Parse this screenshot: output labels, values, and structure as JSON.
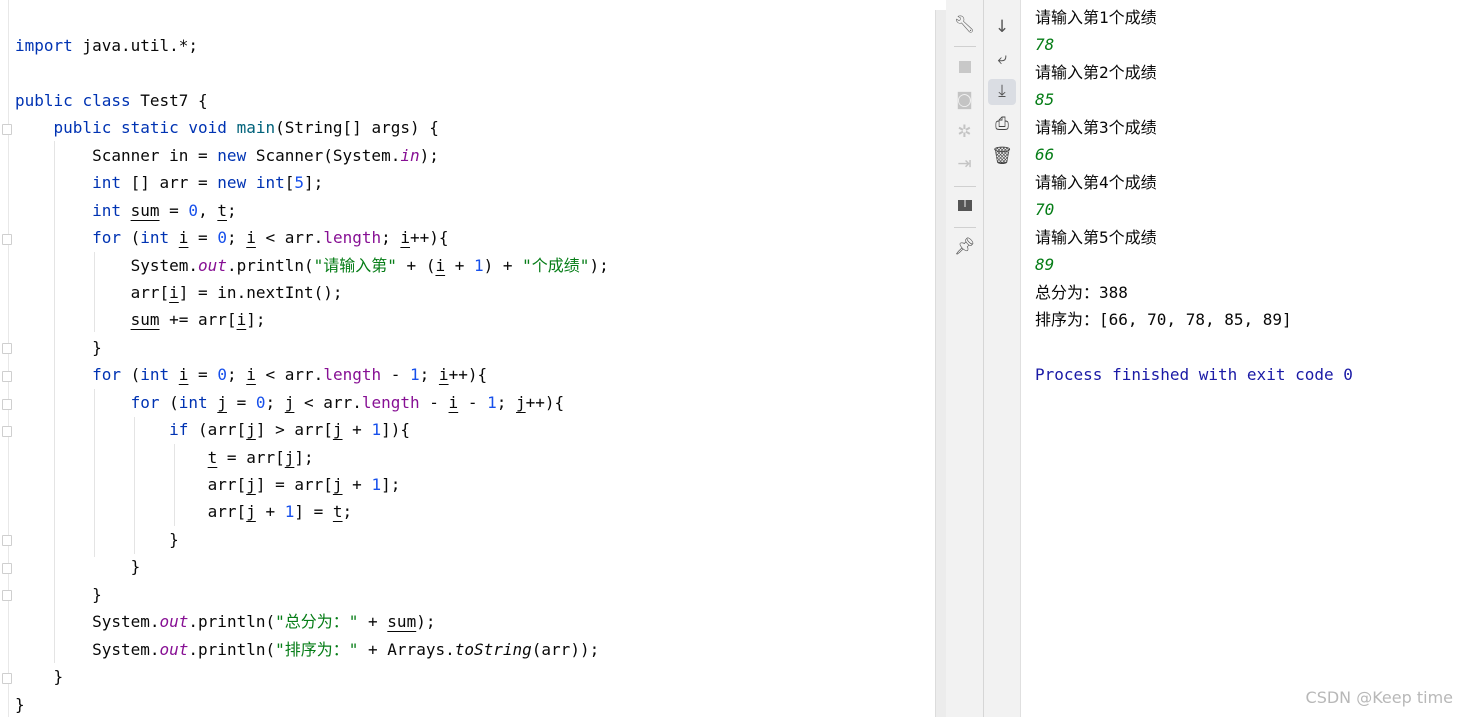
{
  "editor": {
    "lines": [
      [
        [
          "import",
          "k"
        ],
        " java.util.*;"
      ],
      [],
      [
        [
          "public",
          "k"
        ],
        " ",
        [
          "class",
          "k"
        ],
        " Test7 {"
      ],
      [
        "    ",
        [
          "public",
          "k"
        ],
        " ",
        [
          "static",
          "k"
        ],
        " ",
        [
          "void",
          "k"
        ],
        " ",
        [
          "main",
          "m"
        ],
        "(String[] args) {"
      ],
      [
        "        Scanner in = ",
        [
          "new",
          "k"
        ],
        " Scanner(System.",
        [
          "in",
          "f"
        ],
        ");"
      ],
      [
        "        ",
        [
          "int",
          "k"
        ],
        " [] arr = ",
        [
          "new",
          "k"
        ],
        " ",
        [
          "int",
          "k"
        ],
        "[",
        [
          "5",
          "n"
        ],
        "];"
      ],
      [
        "        ",
        [
          "int",
          "k"
        ],
        " ",
        [
          "sum",
          "u"
        ],
        " = ",
        [
          "0",
          "n"
        ],
        ", ",
        [
          "t",
          "u"
        ],
        ";"
      ],
      [
        "        ",
        [
          "for",
          "k"
        ],
        " (",
        [
          "int",
          "k"
        ],
        " ",
        [
          "i",
          "u"
        ],
        " = ",
        [
          "0",
          "n"
        ],
        "; ",
        [
          "i",
          "u"
        ],
        " < arr.",
        [
          "length",
          "fl"
        ],
        "; ",
        [
          "i",
          "u"
        ],
        "++){"
      ],
      [
        "            System.",
        [
          "out",
          "f"
        ],
        ".println(",
        [
          "\"请输入第\"",
          "s"
        ],
        " + (",
        [
          "i",
          "u"
        ],
        " + ",
        [
          "1",
          "n"
        ],
        ") + ",
        [
          "\"个成绩\"",
          "s"
        ],
        ");"
      ],
      [
        "            arr[",
        [
          "i",
          "u"
        ],
        "] = in.nextInt();"
      ],
      [
        "            ",
        [
          "sum",
          "u"
        ],
        " += arr[",
        [
          "i",
          "u"
        ],
        "];"
      ],
      [
        "        }"
      ],
      [
        "        ",
        [
          "for",
          "k"
        ],
        " (",
        [
          "int",
          "k"
        ],
        " ",
        [
          "i",
          "u"
        ],
        " = ",
        [
          "0",
          "n"
        ],
        "; ",
        [
          "i",
          "u"
        ],
        " < arr.",
        [
          "length",
          "fl"
        ],
        " - ",
        [
          "1",
          "n"
        ],
        "; ",
        [
          "i",
          "u"
        ],
        "++){"
      ],
      [
        "            ",
        [
          "for",
          "k"
        ],
        " (",
        [
          "int",
          "k"
        ],
        " ",
        [
          "j",
          "u"
        ],
        " = ",
        [
          "0",
          "n"
        ],
        "; ",
        [
          "j",
          "u"
        ],
        " < arr.",
        [
          "length",
          "fl"
        ],
        " - ",
        [
          "i",
          "u"
        ],
        " - ",
        [
          "1",
          "n"
        ],
        "; ",
        [
          "j",
          "u"
        ],
        "++){"
      ],
      [
        "                ",
        [
          "if",
          "k"
        ],
        " (arr[",
        [
          "j",
          "u"
        ],
        "] > arr[",
        [
          "j",
          "u"
        ],
        " + ",
        [
          "1",
          "n"
        ],
        "]){"
      ],
      [
        "                    ",
        [
          "t",
          "u"
        ],
        " = arr[",
        [
          "j",
          "u"
        ],
        "];"
      ],
      [
        "                    arr[",
        [
          "j",
          "u"
        ],
        "] = arr[",
        [
          "j",
          "u"
        ],
        " + ",
        [
          "1",
          "n"
        ],
        "];"
      ],
      [
        "                    arr[",
        [
          "j",
          "u"
        ],
        " + ",
        [
          "1",
          "n"
        ],
        "] = ",
        [
          "t",
          "u"
        ],
        ";"
      ],
      [
        "                }"
      ],
      [
        "            }"
      ],
      [
        "        }"
      ],
      [
        "        System.",
        [
          "out",
          "f"
        ],
        ".println(",
        [
          "\"总分为：\"",
          "s"
        ],
        " + ",
        [
          "sum",
          "u"
        ],
        ");"
      ],
      [
        "        System.",
        [
          "out",
          "f"
        ],
        ".println(",
        [
          "\"排序为：\"",
          "s"
        ],
        " + Arrays.",
        [
          "toString",
          "si"
        ],
        "(arr));"
      ],
      [
        "    }"
      ],
      [
        "}"
      ]
    ]
  },
  "toolbar_left": {
    "icons": [
      "wrench-icon",
      "stop-icon",
      "camera-icon",
      "debug-icon",
      "login-icon",
      "layout-icon",
      "pin-icon"
    ]
  },
  "toolbar_right": {
    "icons": [
      "arrow-down-icon",
      "soft-wrap-icon",
      "scroll-to-end-icon",
      "print-icon",
      "trash-icon"
    ]
  },
  "console": {
    "lines": [
      {
        "text": "请输入第1个成绩",
        "type": "out"
      },
      {
        "text": "78",
        "type": "in"
      },
      {
        "text": "请输入第2个成绩",
        "type": "out"
      },
      {
        "text": "85",
        "type": "in"
      },
      {
        "text": "请输入第3个成绩",
        "type": "out"
      },
      {
        "text": "66",
        "type": "in"
      },
      {
        "text": "请输入第4个成绩",
        "type": "out"
      },
      {
        "text": "70",
        "type": "in"
      },
      {
        "text": "请输入第5个成绩",
        "type": "out"
      },
      {
        "text": "89",
        "type": "in"
      },
      {
        "text": "总分为：388",
        "type": "out"
      },
      {
        "text": "排序为：[66, 70, 78, 85, 89]",
        "type": "out"
      },
      {
        "text": "",
        "type": "out"
      },
      {
        "text": "Process finished with exit code 0",
        "type": "proc"
      }
    ]
  },
  "watermark": "CSDN @Keep time",
  "colors": {
    "keyword": "#0033b3",
    "number": "#1750eb",
    "string": "#067d17",
    "field": "#871094",
    "input": "#067d17"
  }
}
